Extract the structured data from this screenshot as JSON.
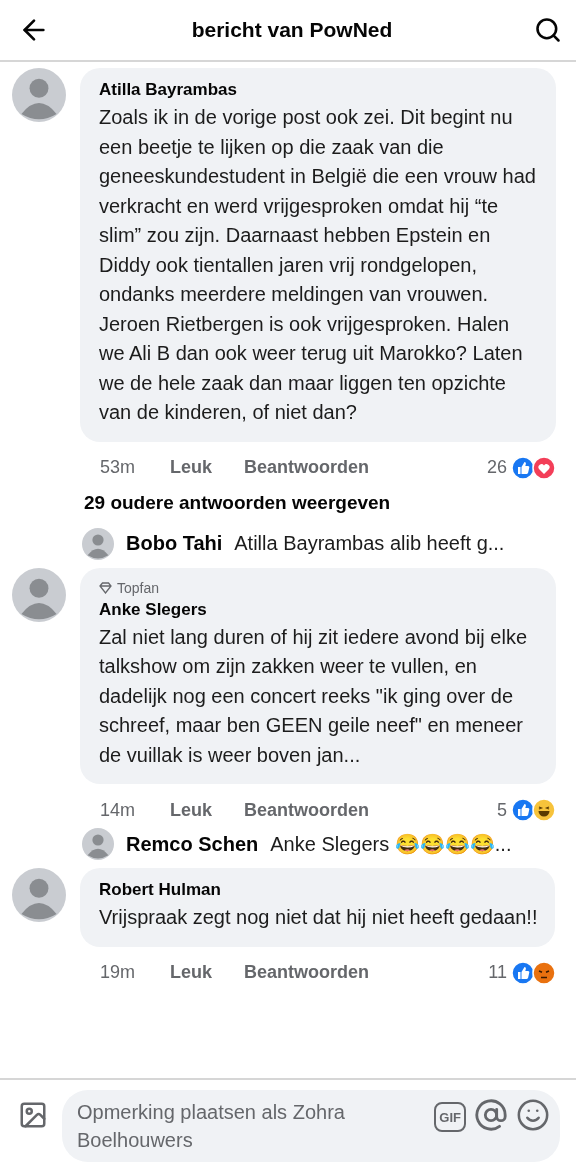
{
  "header": {
    "title": "bericht van PowNed"
  },
  "items": [
    {
      "kind": "comment",
      "author": "Atilla Bayrambas",
      "text": "Zoals ik in de vorige post ook zei. Dit begint nu een beetje te lijken op die zaak van die geneeskundestudent in België die een vrouw had verkracht en werd vrijgesproken omdat hij “te slim” zou zijn. Daarnaast hebben Epstein en Diddy ook tientallen jaren vrij rondgelopen, ondanks meerdere meldingen van vrouwen. Jeroen Rietbergen is ook vrijgesproken. Halen we Ali B dan ook weer terug uit Marokko? Laten we de hele zaak dan maar liggen ten opzichte van de kinderen, of niet dan?",
      "time": "53m",
      "like": "Leuk",
      "reply": "Beantwoorden",
      "count": "26",
      "reactions": [
        {
          "kind": "like"
        },
        {
          "kind": "love"
        }
      ]
    },
    {
      "kind": "more",
      "text": "29 oudere antwoorden weergeven"
    },
    {
      "kind": "reply",
      "author": "Bobo Tahi",
      "text": "Atilla Bayrambas alib heeft g..."
    },
    {
      "kind": "comment",
      "badge": "Topfan",
      "author": "Anke Slegers",
      "text": "Zal niet lang duren of hij zit iedere avond bij elke talkshow om zijn zakken weer te vullen, en dadelijk nog een concert reeks \"ik ging over de schreef, maar ben GEEN geile neef\" en meneer de vuillak is weer boven jan...",
      "time": "14m",
      "like": "Leuk",
      "reply": "Beantwoorden",
      "count": "5",
      "reactions": [
        {
          "kind": "like"
        },
        {
          "kind": "haha"
        }
      ]
    },
    {
      "kind": "reply",
      "author": "Remco Schen",
      "text": "Anke Slegers 😂😂😂😂..."
    },
    {
      "kind": "comment",
      "author": "Robert Hulman",
      "text": "Vrijspraak zegt nog niet  dat hij niet heeft gedaan!!",
      "time": "19m",
      "like": "Leuk",
      "reply": "Beantwoorden",
      "count": "11",
      "reactions": [
        {
          "kind": "like"
        },
        {
          "kind": "angry"
        }
      ]
    }
  ],
  "composer": {
    "placeholder": "Opmerking plaatsen als Zohra Boelhouwers",
    "gif_label": "GIF"
  }
}
